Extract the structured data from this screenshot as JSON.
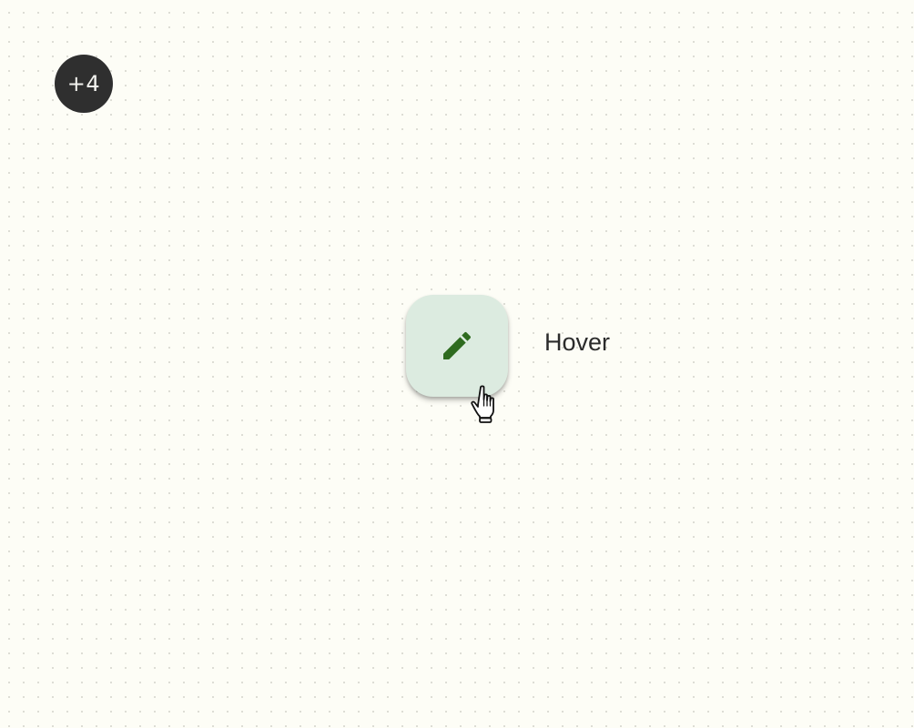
{
  "badge": {
    "label": "+4"
  },
  "fab": {
    "icon": "pencil-icon",
    "background": "#dcebe0",
    "icon_color": "#2e6b1f",
    "state": "hover"
  },
  "state_label": {
    "text": "Hover"
  },
  "cursor": {
    "icon": "hand-pointer-icon"
  }
}
